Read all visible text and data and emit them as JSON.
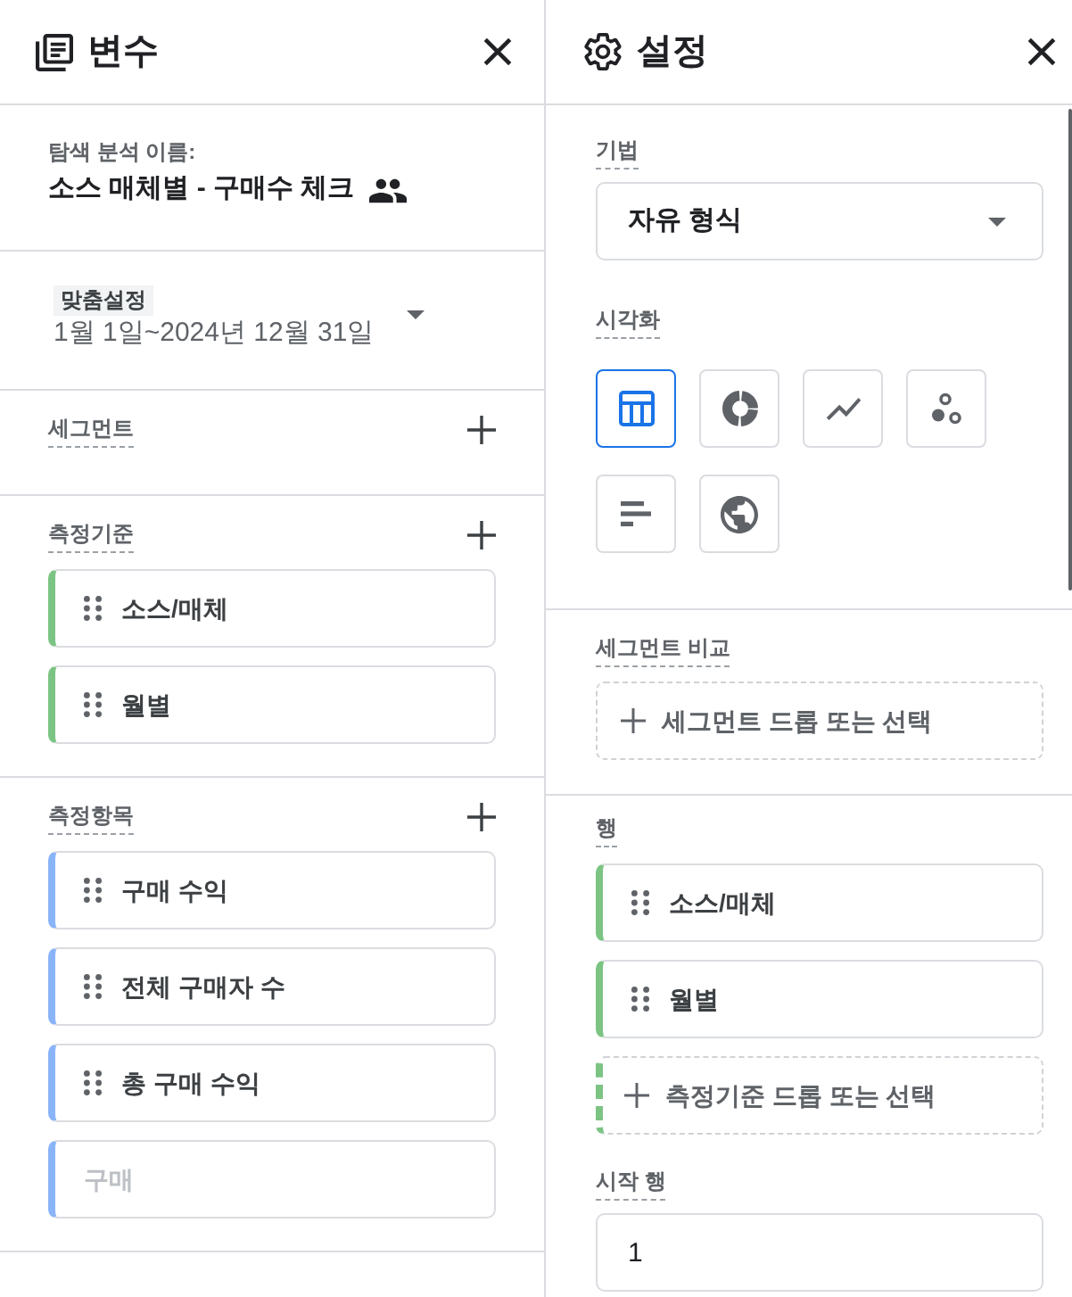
{
  "variables_panel": {
    "title": "변수",
    "exploration_name": {
      "label": "탐색 분석 이름:",
      "value": "소스 매체별 - 구매수 체크"
    },
    "date_range": {
      "preset": "맞춤설정",
      "value": "1월 1일~2024년 12월 31일"
    },
    "segments": {
      "label": "세그먼트"
    },
    "dimensions": {
      "label": "측정기준",
      "items": [
        "소스/매체",
        "월별"
      ]
    },
    "metrics": {
      "label": "측정항목",
      "items": [
        "구매 수익",
        "전체 구매자 수",
        "총 구매 수익"
      ],
      "search": {
        "placeholder": "구매"
      }
    }
  },
  "settings_panel": {
    "title": "설정",
    "technique": {
      "label": "기법",
      "value": "자유 형식"
    },
    "visualization": {
      "label": "시각화",
      "options": [
        {
          "kind": "table",
          "selected": true
        },
        {
          "kind": "donut",
          "selected": false
        },
        {
          "kind": "line",
          "selected": false
        },
        {
          "kind": "scatter",
          "selected": false
        },
        {
          "kind": "bar",
          "selected": false
        },
        {
          "kind": "globe",
          "selected": false
        }
      ]
    },
    "segment_comparison": {
      "label": "세그먼트 비교",
      "drop_zone": "세그먼트 드롭 또는 선택"
    },
    "rows": {
      "label": "행",
      "items": [
        "소스/매체",
        "월별"
      ],
      "drop_zone": "측정기준 드롭 또는 선택"
    },
    "start_row": {
      "label": "시작 행",
      "value": "1"
    }
  }
}
